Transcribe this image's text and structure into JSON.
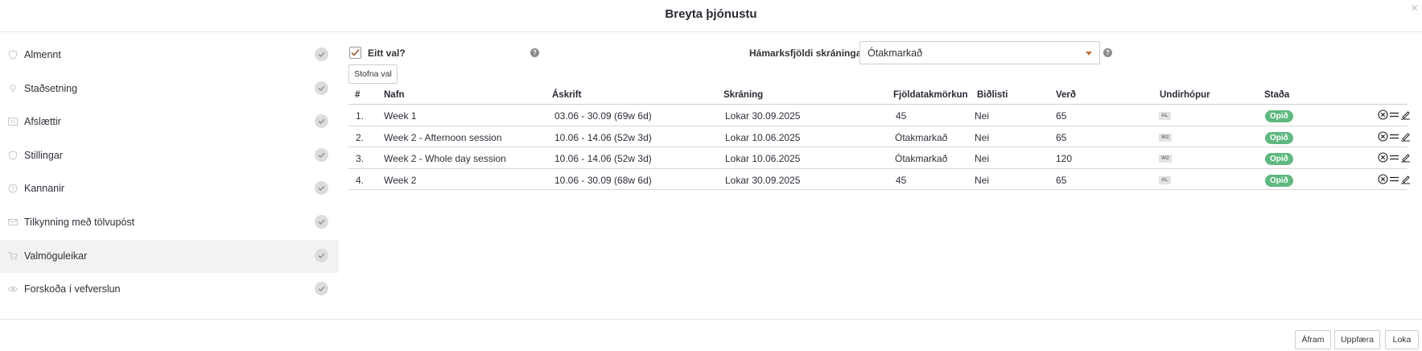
{
  "dialog": {
    "title": "Breyta þjónustu",
    "close_glyph": "×"
  },
  "sidebar": {
    "items": [
      {
        "label": "Almennt",
        "icon": "shield-icon",
        "active": false
      },
      {
        "label": "Staðsetning",
        "icon": "map-pin-icon",
        "active": false
      },
      {
        "label": "Afslættir",
        "icon": "percent-icon",
        "active": false
      },
      {
        "label": "Stillingar",
        "icon": "shield-icon",
        "active": false
      },
      {
        "label": "Kannanir",
        "icon": "question-icon",
        "active": false
      },
      {
        "label": "Tilkynning með tölvupóst",
        "icon": "envelope-icon",
        "active": false
      },
      {
        "label": "Valmöguleikar",
        "icon": "cart-icon",
        "active": true
      },
      {
        "label": "Forskoða í vefverslun",
        "icon": "eye-icon",
        "active": false
      }
    ],
    "check_icon": "check-icon"
  },
  "options": {
    "eitt_val_label": "Eitt val?",
    "eitt_val_checked": true,
    "max_label": "Hámarksfjöldi skráninga",
    "max_value": "Ótakmarkað",
    "help_glyph": "?",
    "create_button": "Stofna val"
  },
  "table": {
    "headers": {
      "num": "#",
      "name": "Nafn",
      "subscription": "Áskrift",
      "registration": "Skráning",
      "limit": "Fjöldatakmörkun",
      "waitlist": "Biðlisti",
      "price": "Verð",
      "subgroup": "Undirhópur",
      "status": "Staða"
    },
    "rows": [
      {
        "num": "1.",
        "name": "Week 1",
        "subscription": "03.06 - 30.09 (69w 6d)",
        "registration": "Lokar 30.09.2025",
        "limit": "45",
        "waitlist": "Nei",
        "price": "65",
        "subgroup": "AL",
        "status": "Opið"
      },
      {
        "num": "2.",
        "name": "Week 2 - Afternoon session",
        "subscription": "10.06 - 14.06 (52w 3d)",
        "registration": "Lokar 10.06.2025",
        "limit": "Ótakmarkað",
        "waitlist": "Nei",
        "price": "65",
        "subgroup": "W2",
        "status": "Opið"
      },
      {
        "num": "3.",
        "name": "Week 2 - Whole day session",
        "subscription": "10.06 - 14.06 (52w 3d)",
        "registration": "Lokar 10.06.2025",
        "limit": "Ótakmarkað",
        "waitlist": "Nei",
        "price": "120",
        "subgroup": "W2",
        "status": "Opið"
      },
      {
        "num": "4.",
        "name": "Week 2",
        "subscription": "10.06 - 30.09 (68w 6d)",
        "registration": "Lokar 30.09.2025",
        "limit": "45",
        "waitlist": "Nei",
        "price": "65",
        "subgroup": "AL",
        "status": "Opið"
      }
    ]
  },
  "footer": {
    "next_button": "Áfram",
    "update_button": "Uppfæra",
    "close_button": "Loka"
  },
  "colors": {
    "status_green": "#5fb87f",
    "caret_orange": "#c0723a",
    "active_row_bg": "#f2f2f2"
  }
}
